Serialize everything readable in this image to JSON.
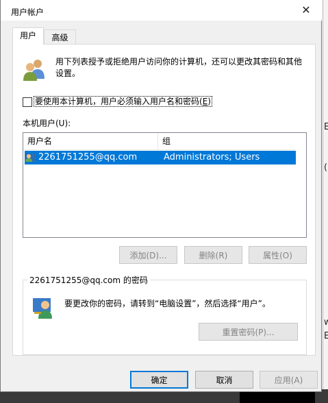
{
  "window": {
    "title": "用户帐户",
    "close_glyph": "✕"
  },
  "tabs": [
    {
      "label": "用户",
      "active": true
    },
    {
      "label": "高级",
      "active": false
    }
  ],
  "description": "用下列表授予或拒绝用户访问你的计算机，还可以更改其密码和其他设置。",
  "require_login": {
    "label_prefix": "要使用本计算机，用户必须输入用户名和密码(",
    "label_key": "E",
    "label_suffix": ")",
    "checked": false
  },
  "users_list": {
    "label": "本机用户(U):",
    "columns": [
      "用户名",
      "组"
    ],
    "rows": [
      {
        "username": "2261751255@qq.com",
        "group": "Administrators; Users",
        "selected": true
      }
    ]
  },
  "list_buttons": {
    "add": "添加(D)...",
    "remove": "删除(R)",
    "properties": "属性(O)"
  },
  "password_group": {
    "label": "2261751255@qq.com 的密码",
    "text": "要更改你的密码，请转到“电脑设置”，然后选择“用户”。",
    "reset_button": "重置密码(P)..."
  },
  "footer": {
    "ok": "确定",
    "cancel": "取消",
    "apply": "应用(A)"
  },
  "background_fragments": {
    "frag1": "E",
    "frag2": "(",
    "frag3": "w",
    "frag4": "E"
  },
  "colors": {
    "selection": "#0078d7",
    "accent": "#0078d7"
  },
  "icons": {
    "users": "users-icon",
    "user_row": "user-icon",
    "password": "user-key-icon",
    "close": "close-icon"
  }
}
